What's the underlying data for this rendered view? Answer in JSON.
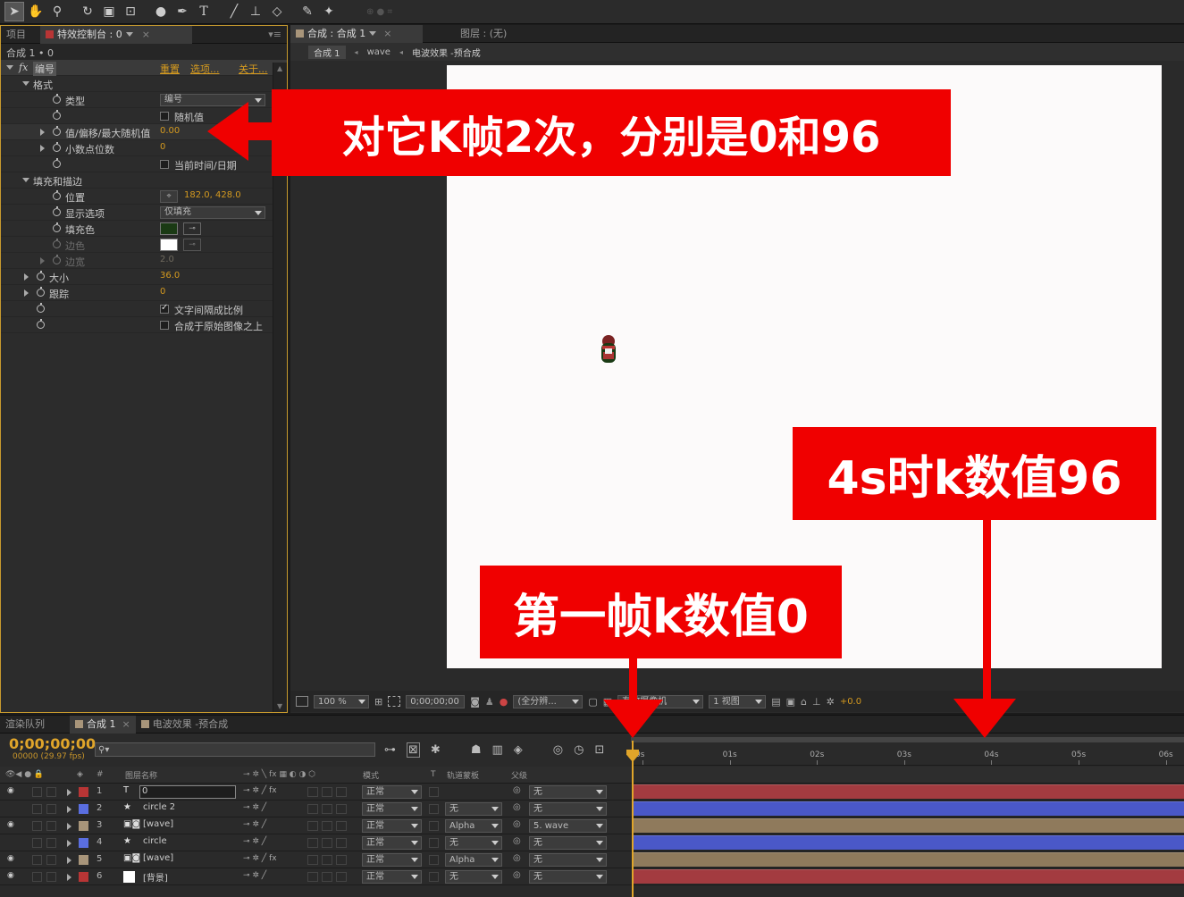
{
  "toolbar": {
    "icons": [
      "selection-tool",
      "hand-tool",
      "zoom-tool",
      "rotate-tool",
      "camera-tool",
      "pan-behind-tool",
      "ellipse-tool",
      "pen-tool",
      "type-tool",
      "brush-tool",
      "clone-stamp-tool",
      "eraser-tool",
      "roto-brush-tool",
      "puppet-pin-tool"
    ],
    "type_glyph": "T"
  },
  "effects_panel": {
    "tab_project": "项目",
    "tab_effects": "特效控制台 : 0",
    "breadcrumb": "合成 1 • 0",
    "fx_badge": "fx",
    "effect_name": "编号",
    "reset": "重置",
    "options": "选项...",
    "about": "关于...",
    "format_group": "格式",
    "type_label": "类型",
    "type_value": "编号",
    "random_label": "随机值",
    "value_label": "值/偏移/最大随机值",
    "value": "0.00",
    "decimals_label": "小数点位数",
    "decimals_value": "0",
    "current_time_label": "当前时间/日期",
    "fill_group": "填充和描边",
    "position_label": "位置",
    "position_value": "182.0, 428.0",
    "display_label": "显示选项",
    "display_value": "仅填充",
    "fill_color_label": "填充色",
    "fill_color": "#1a3a14",
    "stroke_color_label": "边色",
    "stroke_color": "#ffffff",
    "stroke_width_label": "边宽",
    "stroke_width_value": "2.0",
    "size_label": "大小",
    "size_value": "36.0",
    "tracking_label": "跟踪",
    "tracking_value": "0",
    "proportional_label": "文字间隔成比例",
    "composite_label": "合成于原始图像之上"
  },
  "viewer": {
    "tab_comp": "合成 : 合成 1",
    "tab_layer": "图层 : (无)",
    "crumbs": [
      "合成 1",
      "wave",
      "电波效果 -预合成"
    ],
    "zoom": "100 %",
    "timecode": "0;00;00;00",
    "resolution": "(全分辨...",
    "camera": "有效摄像机",
    "views": "1 视图",
    "exposure": "+0.0"
  },
  "timeline": {
    "tab_render": "渲染队列",
    "tab_comp": "合成 1",
    "tab_precomp": "电波效果 -预合成",
    "timecode": "0;00;00;00",
    "fps": "00000 (29.97 fps)",
    "col_num": "#",
    "col_name": "图层名称",
    "col_mode": "模式",
    "col_t": "T",
    "col_track": "轨道蒙板",
    "col_parent": "父级",
    "ruler": [
      "0s",
      "01s",
      "02s",
      "03s",
      "04s",
      "05s",
      "06s"
    ],
    "layers": [
      {
        "num": "1",
        "name": "0",
        "color": "#b83535",
        "type": "T",
        "mode": "正常",
        "track": "",
        "parent": "无",
        "bar": "#a33b40",
        "fx": true,
        "eye": true
      },
      {
        "num": "2",
        "name": "circle 2",
        "color": "#5a6ee0",
        "type": "★",
        "mode": "正常",
        "track": "无",
        "parent": "无",
        "bar": "#4a58c8",
        "fx": false,
        "eye": false
      },
      {
        "num": "3",
        "name": "[wave]",
        "color": "#a8957a",
        "type": "comp",
        "mode": "正常",
        "track": "Alpha",
        "parent": "5. wave",
        "bar": "#8f7a5c",
        "fx": false,
        "eye": true
      },
      {
        "num": "4",
        "name": "circle",
        "color": "#5a6ee0",
        "type": "★",
        "mode": "正常",
        "track": "无",
        "parent": "无",
        "bar": "#4a58c8",
        "fx": false,
        "eye": false
      },
      {
        "num": "5",
        "name": "[wave]",
        "color": "#a8957a",
        "type": "comp",
        "mode": "正常",
        "track": "Alpha",
        "parent": "无",
        "bar": "#8f7a5c",
        "fx": true,
        "eye": true
      },
      {
        "num": "6",
        "name": "[背景]",
        "color": "#b83535",
        "type": "solid",
        "mode": "正常",
        "track": "无",
        "parent": "无",
        "bar": "#a33b40",
        "fx": false,
        "eye": true
      }
    ]
  },
  "callouts": {
    "top": "对它K帧2次，分别是0和96",
    "right": "4s时k数值96",
    "bottom": "第一帧k数值0"
  },
  "colors": {
    "annotation_red": "#f00000",
    "panel_highlight": "#c79a2e",
    "value_orange": "#d59a1f"
  }
}
